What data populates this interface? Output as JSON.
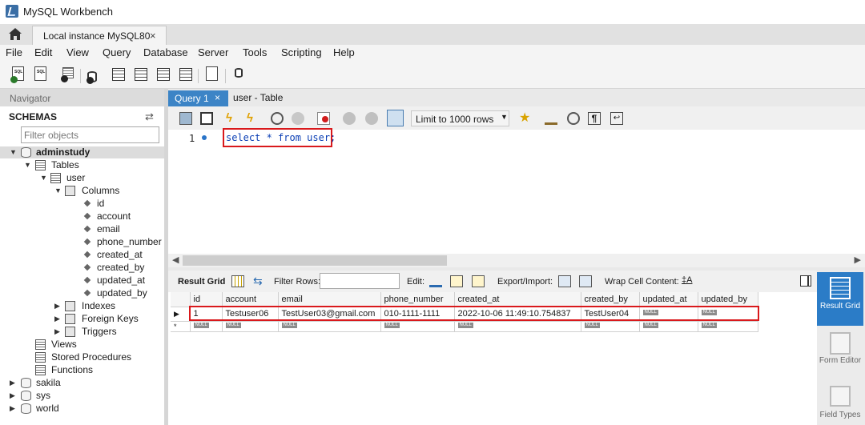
{
  "window": {
    "title": "MySQL Workbench"
  },
  "connection_tab": {
    "label": "Local instance MySQL80",
    "close": "×"
  },
  "menu": [
    "File",
    "Edit",
    "View",
    "Query",
    "Database",
    "Server",
    "Tools",
    "Scripting",
    "Help"
  ],
  "navigator": {
    "header": "Navigator",
    "schemas_label": "SCHEMAS",
    "filter_placeholder": "Filter objects",
    "tree": {
      "schema": "adminstudy",
      "tables": "Tables",
      "table": "user",
      "columns_label": "Columns",
      "columns": [
        "id",
        "account",
        "email",
        "phone_number",
        "created_at",
        "created_by",
        "updated_at",
        "updated_by"
      ],
      "indexes": "Indexes",
      "foreign_keys": "Foreign Keys",
      "triggers": "Triggers",
      "views": "Views",
      "stored_procedures": "Stored Procedures",
      "functions": "Functions",
      "other_schemas": [
        "sakila",
        "sys",
        "world"
      ]
    }
  },
  "editor_tabs": [
    {
      "label": "Query 1",
      "close": "×",
      "active": true
    },
    {
      "label": "user - Table",
      "active": false
    }
  ],
  "editor_toolbar": {
    "limit": "Limit to 1000 rows"
  },
  "editor": {
    "line_number": "1",
    "sql": "select * from user;"
  },
  "result_toolbar": {
    "result_grid": "Result Grid",
    "filter_rows": "Filter Rows:",
    "edit": "Edit:",
    "export_import": "Export/Import:",
    "wrap": "Wrap Cell Content:"
  },
  "result_grid": {
    "columns": [
      "id",
      "account",
      "email",
      "phone_number",
      "created_at",
      "created_by",
      "updated_at",
      "updated_by"
    ],
    "rows": [
      [
        "1",
        "Testuser06",
        "TestUser03@gmail.com",
        "010-1111-1111",
        "2022-10-06 11:49:10.754837",
        "TestUser04",
        "NULL",
        "NULL"
      ]
    ],
    "null_label": "NULL",
    "new_row_marker": "*"
  },
  "side_panel": {
    "result_grid": "Result Grid",
    "form_editor": "Form Editor",
    "field_types": "Field Types"
  },
  "colors": {
    "accent": "#3c84c6",
    "highlight": "#d9191c"
  }
}
